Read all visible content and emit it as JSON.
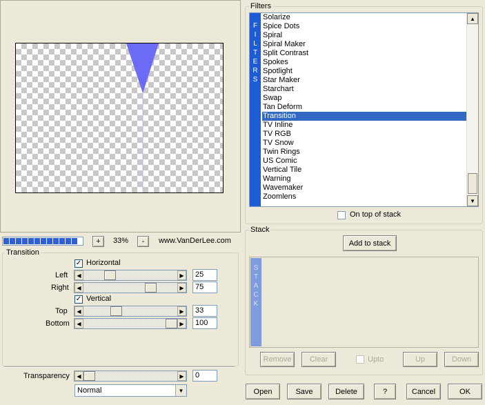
{
  "zoom": {
    "plus": "+",
    "value": "33%",
    "minus": "-",
    "link": "www.VanDerLee.com",
    "progress_blocks": 12
  },
  "transition": {
    "title": "Transition",
    "horizontal_label": "Horizontal",
    "horizontal_checked": true,
    "left_label": "Left",
    "left_value": "25",
    "left_level": 25,
    "right_label": "Right",
    "right_value": "75",
    "right_level": 75,
    "vertical_label": "Vertical",
    "vertical_checked": true,
    "top_label": "Top",
    "top_value": "33",
    "top_level": 33,
    "bottom_label": "Bottom",
    "bottom_value": "100",
    "bottom_level": 100
  },
  "transparency": {
    "label": "Transparency",
    "value": "0",
    "level": 0,
    "mode": "Normal"
  },
  "filters": {
    "title": "Filters",
    "band": [
      "F",
      "I",
      "L",
      "T",
      "E",
      "R",
      "S"
    ],
    "items": [
      "Solarize",
      "Spice Dots",
      "Spiral",
      "Spiral Maker",
      "Split Contrast",
      "Spokes",
      "Spotlight",
      "Star Maker",
      "Starchart",
      "Swap",
      "Tan Deform",
      "Transition",
      "TV Inline",
      "TV RGB",
      "TV Snow",
      "Twin Rings",
      "US Comic",
      "Vertical Tile",
      "Warning",
      "Wavemaker",
      "Zoomlens"
    ],
    "selected_index": 11,
    "on_top_label": "On top of stack"
  },
  "stack": {
    "title": "Stack",
    "add_label": "Add to stack",
    "band": [
      "S",
      "T",
      "A",
      "C",
      "K"
    ],
    "remove_label": "Remove",
    "clear_label": "Clear",
    "upto_label": "Upto",
    "up_label": "Up",
    "down_label": "Down"
  },
  "buttons": {
    "open": "Open",
    "save": "Save",
    "delete": "Delete",
    "help": "?",
    "cancel": "Cancel",
    "ok": "OK"
  },
  "colors": {
    "accent": "#316ac5",
    "band": "#1e5cd6",
    "preview_shape": "#6b6bf5"
  }
}
